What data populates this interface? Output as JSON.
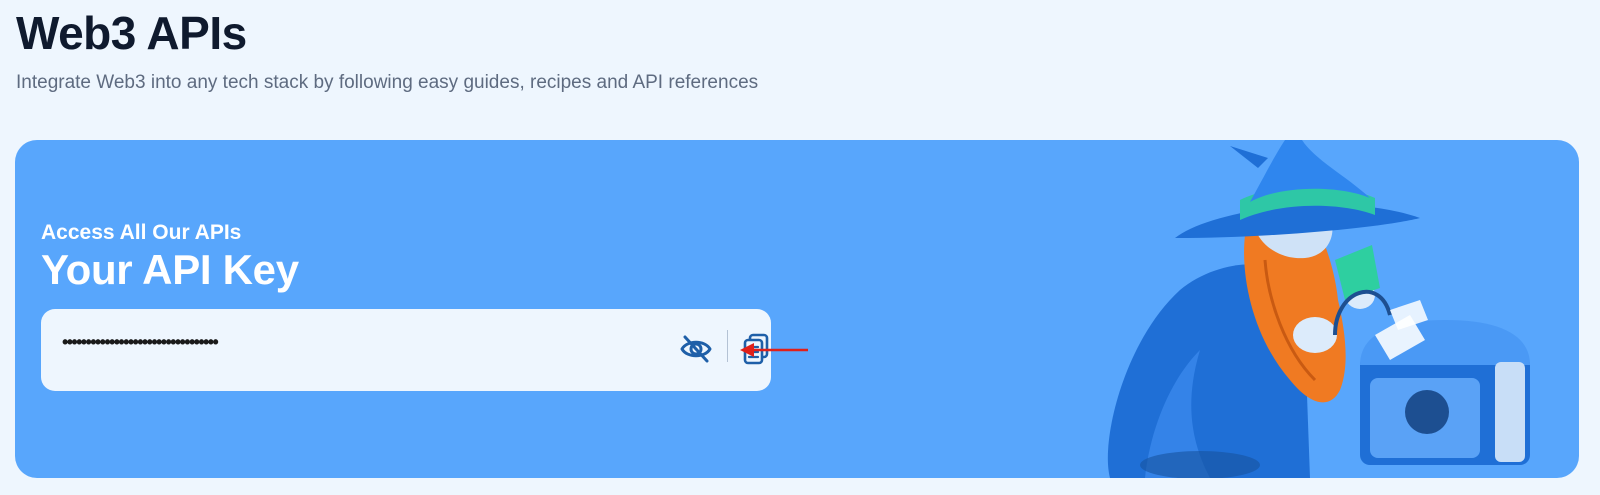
{
  "header": {
    "title": "Web3 APIs",
    "subtitle": "Integrate Web3 into any tech stack by following easy guides, recipes and API references"
  },
  "banner": {
    "eyebrow": "Access All Our APIs",
    "title": "Your API Key",
    "key_field": {
      "masked_value": "•••••••••••••••••••••••••••••••••"
    },
    "icons": {
      "visibility": "eye-slash-icon",
      "copy": "copy-icon"
    }
  },
  "colors": {
    "banner_bg": "#58a6fc",
    "field_bg": "#eef6fe",
    "icon": "#1e5fa8",
    "arrow": "#e0201a",
    "title": "#0f1a2e"
  }
}
